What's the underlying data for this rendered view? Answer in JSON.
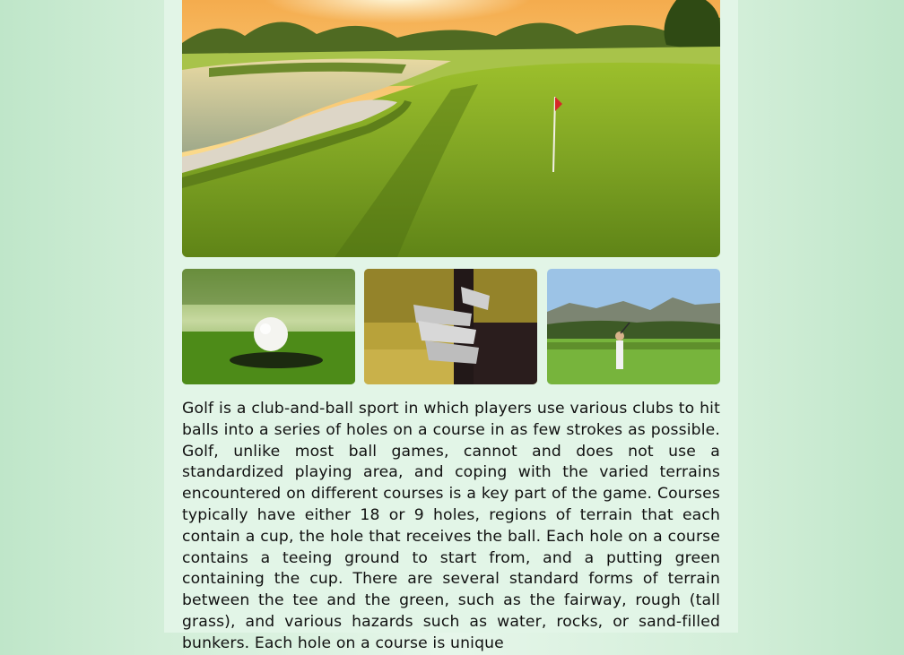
{
  "gallery": {
    "hero_alt": "Golf course green with flag at sunset",
    "thumbnails": [
      {
        "alt": "Golf ball near the hole"
      },
      {
        "alt": "Golf clubs in a bag"
      },
      {
        "alt": "Golfer swinging on a course"
      }
    ]
  },
  "article": {
    "paragraph": "Golf is a club-and-ball sport in which players use various clubs to hit balls into a series of holes on a course in as few strokes as possible. Golf, unlike most ball games, cannot and does not use a standardized playing area, and coping with the varied terrains encountered on different courses is a key part of the game. Courses typically have either 18 or 9 holes, regions of terrain that each contain a cup, the hole that receives the ball. Each hole on a course contains a teeing ground to start from, and a putting green containing the cup. There are several standard forms of terrain between the tee and the green, such as the fairway, rough (tall grass), and various hazards such as water, rocks, or sand-filled bunkers. Each hole on a course is unique"
  },
  "colors": {
    "page_background": "#e2f5e7",
    "side_background": "#bfe6c9",
    "text": "#111111",
    "flag": "#d62828"
  }
}
